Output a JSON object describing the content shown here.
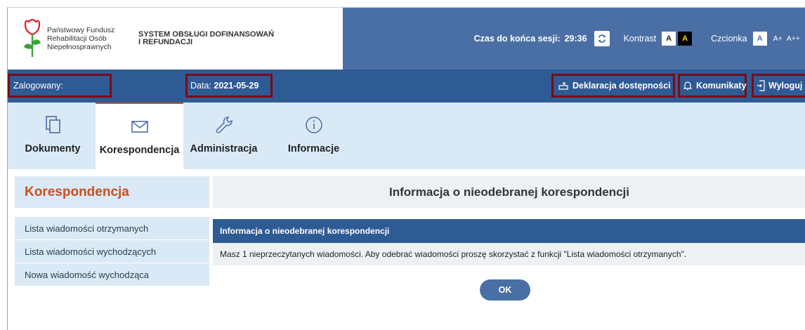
{
  "header": {
    "org_line1": "Państwowy Fundusz",
    "org_line2": "Rehabilitacji Osób",
    "org_line3": "Niepełnosprawnych",
    "system_line1": "SYSTEM OBSŁUGI DOFINANSOWAŃ",
    "system_line2": "I REFUNDACJI",
    "session_label": "Czas do końca sesji:",
    "session_time": "29:36",
    "contrast_label": "Kontrast",
    "contrast_a1": "A",
    "contrast_a2": "A",
    "font_label": "Czcionka",
    "font_a": "A",
    "font_a_plus": "A+",
    "font_a_plus_plus": "A++"
  },
  "nav": {
    "logged_in_label": "Zalogowany:",
    "date_label": "Data:",
    "date_value": "2021-05-29",
    "accessibility_label": "Deklaracja dostępności",
    "messages_label": "Komunikaty",
    "logout_label": "Wyloguj"
  },
  "tabs": [
    {
      "label": "Dokumenty",
      "icon": "documents-icon"
    },
    {
      "label": "Korespondencja",
      "icon": "envelope-icon"
    },
    {
      "label": "Administracja",
      "icon": "wrench-icon"
    },
    {
      "label": "Informacje",
      "icon": "info-icon"
    }
  ],
  "sidebar": {
    "title": "Korespondencja",
    "items": [
      {
        "label": "Lista wiadomości otrzymanych"
      },
      {
        "label": "Lista wiadomości wychodzących"
      },
      {
        "label": "Nowa wiadomość wychodząca"
      }
    ]
  },
  "main": {
    "title": "Informacja o nieodebranej korespondencji",
    "panel_header": "Informacja o nieodebranej korespondencji",
    "panel_message": "Masz 1 nieprzeczytanych wiadomości. Aby odebrać wiadomości proszę skorzystać z funkcji \"Lista wiadomości otrzymanych\".",
    "ok_label": "OK"
  },
  "colors": {
    "header_blue": "#4a6fa5",
    "nav_blue": "#2f5b94",
    "tab_bg": "#dae9f6",
    "accent_orange": "#c8501e",
    "highlight_border": "#7a0b16"
  }
}
